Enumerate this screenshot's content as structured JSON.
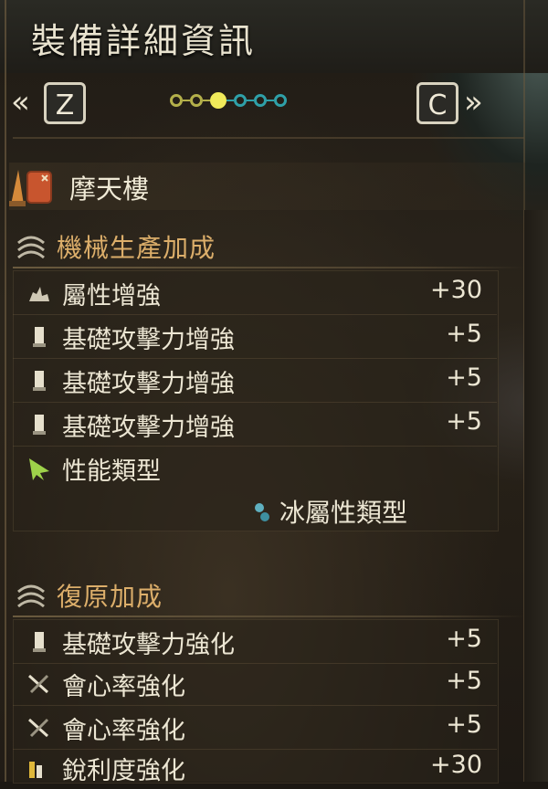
{
  "header": {
    "title": "裝備詳細資訊",
    "prev_key": "Z",
    "next_key": "C",
    "prev_chevron": "«",
    "next_chevron": "»",
    "page_dots_total": 6,
    "page_dots_active_index": 2
  },
  "weapon": {
    "name": "摩天樓",
    "icon": "lance-weapon-icon"
  },
  "sections": [
    {
      "title": "機械生產加成",
      "icon": "augment-swirl-icon",
      "rows": [
        {
          "label": "屬性增強",
          "value": "+30",
          "icon": "element-flame-icon"
        },
        {
          "label": "基礎攻擊力增強",
          "value": "+5",
          "icon": "attack-blade-icon"
        },
        {
          "label": "基礎攻擊力增強",
          "value": "+5",
          "icon": "attack-blade-icon"
        },
        {
          "label": "基礎攻擊力增強",
          "value": "+5",
          "icon": "attack-blade-icon"
        },
        {
          "label": "性能類型",
          "value": "",
          "icon": "performance-arrow-icon"
        }
      ],
      "subtype": {
        "label": "冰屬性類型",
        "icon": "ice-element-icon"
      }
    },
    {
      "title": "復原加成",
      "icon": "augment-swirl-icon",
      "rows": [
        {
          "label": "基礎攻擊力強化",
          "value": "+5",
          "icon": "attack-blade-icon"
        },
        {
          "label": "會心率強化",
          "value": "+5",
          "icon": "affinity-cross-icon"
        },
        {
          "label": "會心率強化",
          "value": "+5",
          "icon": "affinity-cross-icon"
        },
        {
          "label": "銳利度強化",
          "value": "+30",
          "icon": "sharpness-bar-icon"
        }
      ]
    }
  ],
  "colors": {
    "section_title": "#dcae6a",
    "text": "#ece6d3",
    "dot_yellow": "#b4b04a",
    "dot_active": "#f0ea5a",
    "dot_teal": "#2fa0a8"
  }
}
